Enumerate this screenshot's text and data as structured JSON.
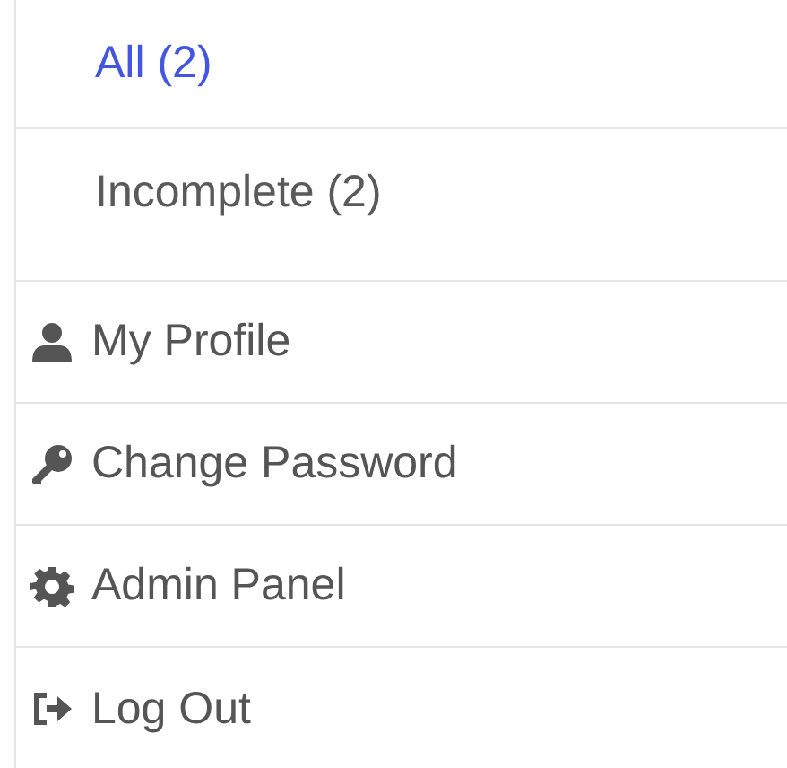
{
  "filters": [
    {
      "label": "All (2)",
      "selected": true
    },
    {
      "label": "Incomplete (2)",
      "selected": false
    }
  ],
  "menu": [
    {
      "label": "My Profile",
      "kind": "person"
    },
    {
      "label": "Change Password",
      "kind": "key"
    },
    {
      "label": "Admin Panel",
      "kind": "gear"
    },
    {
      "label": "Log Out",
      "kind": "logout"
    }
  ]
}
